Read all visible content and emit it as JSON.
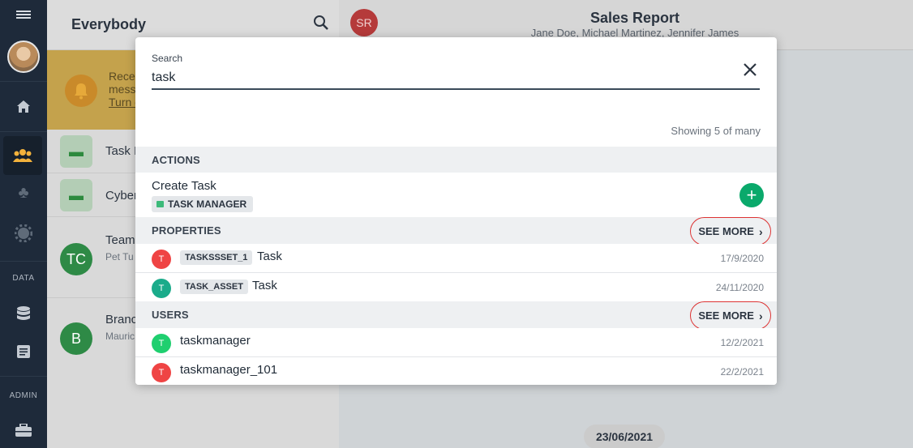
{
  "rail": {
    "data_label": "DATA",
    "admin_label": "ADMIN",
    "icons": [
      "menu-icon",
      "home-icon",
      "people-icon",
      "clubs-icon",
      "gear-icon",
      "database-icon",
      "document-icon",
      "toolbox-icon"
    ]
  },
  "left_panel": {
    "title": "Everybody",
    "banner_lines": [
      "Rece",
      "mess",
      "Turn c"
    ],
    "rows": [
      {
        "label": "Task I"
      },
      {
        "label": "Cyber"
      },
      {
        "label": "Team",
        "sub": "Pet Tu",
        "initials": "TC"
      },
      {
        "label": "Branc",
        "sub": "Mauric",
        "initials": "B"
      }
    ]
  },
  "chat": {
    "avatar_initials": "SR",
    "title": "Sales Report",
    "participants": "Jane Doe, Michael Martinez, Jennifer James",
    "date_chip": "23/06/2021"
  },
  "search_modal": {
    "label": "Search",
    "query": "task",
    "showing": "Showing 5 of many",
    "sections": {
      "actions": "ACTIONS",
      "properties": "PROPERTIES",
      "users": "USERS"
    },
    "see_more": "SEE MORE",
    "action": {
      "name": "Create Task",
      "chip": "TASK MANAGER"
    },
    "properties": [
      {
        "initial": "T",
        "tag": "TASKSSSET_1",
        "name": "Task",
        "date": "17/9/2020",
        "color": "#ef4444"
      },
      {
        "initial": "T",
        "tag": "TASK_ASSET",
        "name": "Task",
        "date": "24/11/2020",
        "color": "#1aab8a"
      }
    ],
    "users": [
      {
        "initial": "T",
        "name": "taskmanager",
        "date": "12/2/2021",
        "color": "#1fcf6f"
      },
      {
        "initial": "T",
        "name": "taskmanager_101",
        "date": "22/2/2021",
        "color": "#ef4444"
      }
    ]
  }
}
